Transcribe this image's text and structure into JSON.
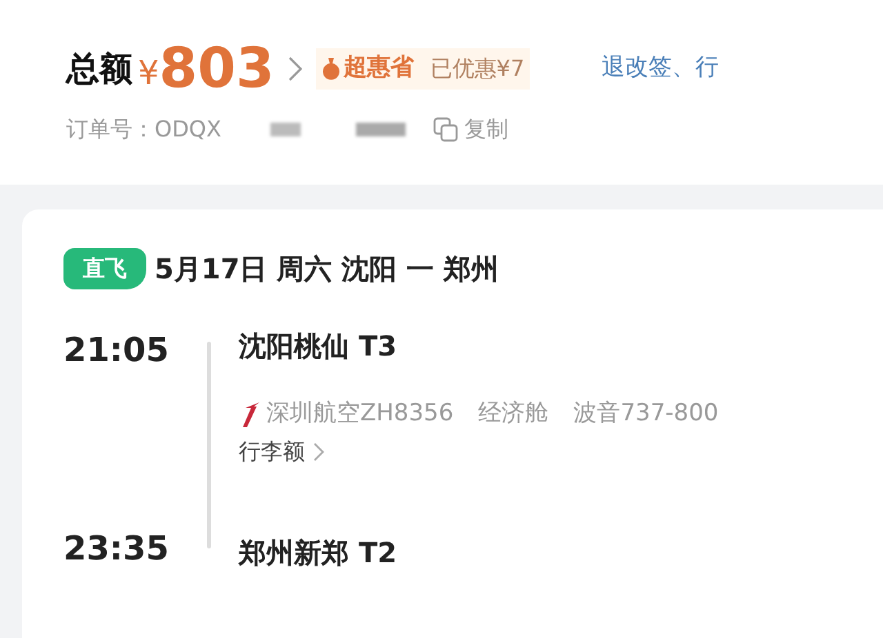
{
  "summary": {
    "total_label": "总额",
    "currency": "¥",
    "amount": "803",
    "badge": "超惠省",
    "discount": "已优惠¥7",
    "link": "退改签、行"
  },
  "order": {
    "label": "订单号：",
    "number": "ODQX",
    "copy": "复制"
  },
  "flight": {
    "tag": "直飞",
    "date_route": "5月17日 周六 沈阳 一 郑州",
    "departure": {
      "time": "21:05",
      "airport": "沈阳桃仙 T3"
    },
    "details": [
      "深圳航空ZH8356",
      "经济舱",
      "波音737-800"
    ],
    "baggage": "行李额",
    "arrival": {
      "time": "23:35",
      "airport": "郑州新郑 T2"
    }
  }
}
